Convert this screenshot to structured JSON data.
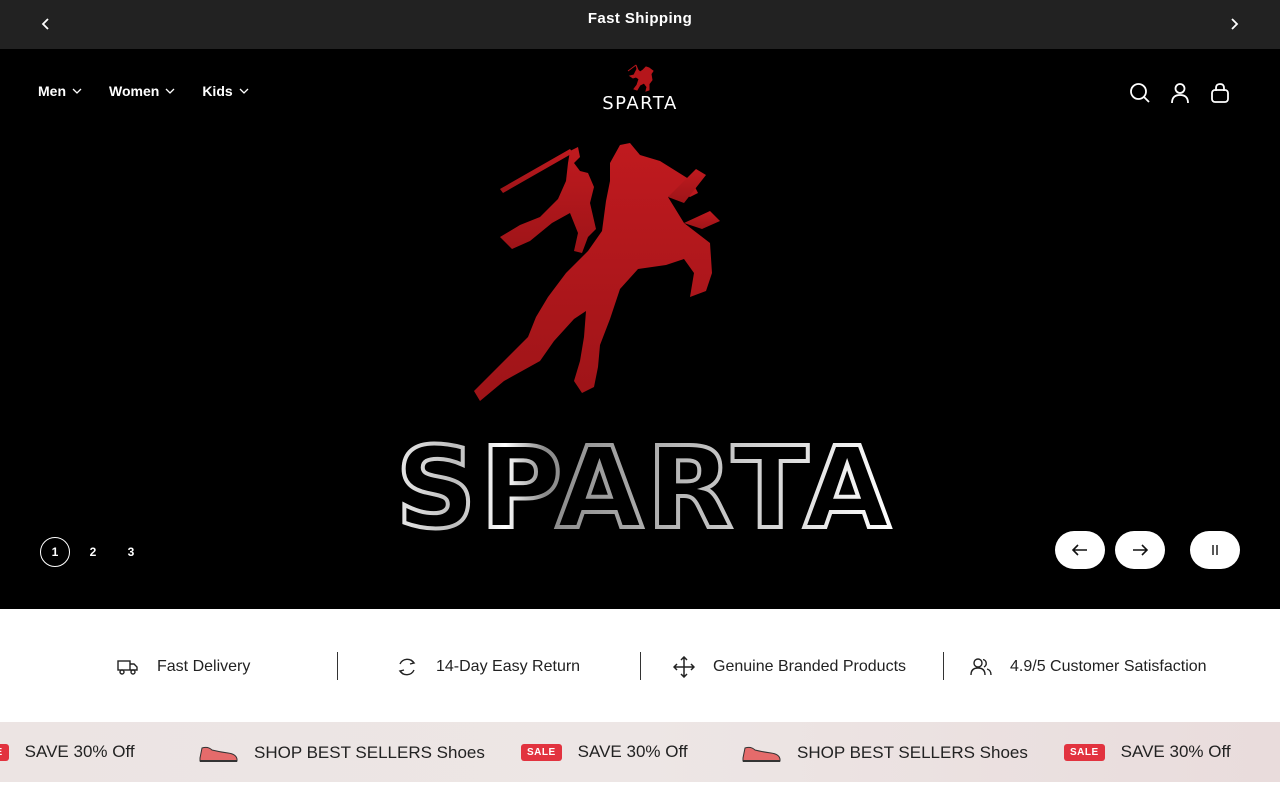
{
  "announcement": {
    "message": "Fast Shipping",
    "prev_icon": "chevron-left-icon",
    "next_icon": "chevron-right-icon"
  },
  "nav": {
    "items": [
      {
        "label": "Men"
      },
      {
        "label": "Women"
      },
      {
        "label": "Kids"
      }
    ]
  },
  "brand": {
    "name": "SPARTA",
    "logo_icon": "horse-rider-logo-icon"
  },
  "header_icons": [
    "search-icon",
    "account-icon",
    "cart-icon"
  ],
  "hero": {
    "wordmark": "SPARTA",
    "slides": [
      "1",
      "2",
      "3"
    ],
    "active_slide": "1",
    "accent_color": "#b5161b"
  },
  "features": [
    {
      "icon": "truck-icon",
      "label": "Fast Delivery"
    },
    {
      "icon": "return-icon",
      "label": "14-Day Easy Return"
    },
    {
      "icon": "move-arrows-icon",
      "label": "Genuine Branded Products"
    },
    {
      "icon": "users-icon",
      "label": "4.9/5 Customer Satisfaction"
    }
  ],
  "marquee": {
    "sale_badge": "SALE",
    "items": [
      {
        "type": "sale",
        "text": "SAVE 30% Off"
      },
      {
        "type": "shoe",
        "text": "SHOP BEST SELLERS Shoes"
      },
      {
        "type": "sale",
        "text": "SAVE 30% Off"
      },
      {
        "type": "shoe",
        "text": "SHOP BEST SELLERS Shoes"
      },
      {
        "type": "sale",
        "text": "SAVE 30% Off"
      }
    ]
  }
}
